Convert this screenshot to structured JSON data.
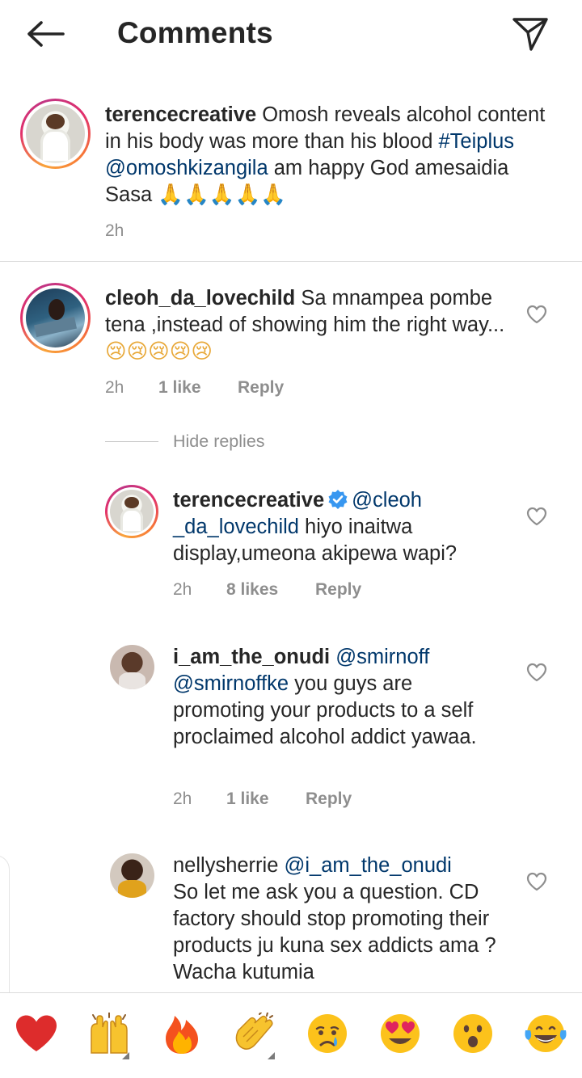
{
  "header": {
    "title": "Comments"
  },
  "caption": {
    "username": "terencecreative",
    "text_before": " Omosh reveals alcohol content in his body was more than his blood ",
    "hashtag": "#Teiplus",
    "space": " ",
    "mention": "@omoshkizangila",
    "text_after": " am happy God amesaidia Sasa ",
    "emojis": "🙏🙏🙏🙏🙏",
    "time": "2h"
  },
  "comments": [
    {
      "username": "cleoh_da_lovechild",
      "text": " Sa mnampea pombe tena ,instead of showing him the right way...",
      "emojis": "😢😢😢😢😢",
      "time": "2h",
      "likes": "1 like",
      "reply": "Reply"
    }
  ],
  "hide_replies": "Hide replies",
  "replies": [
    {
      "username": "terencecreative",
      "mention": "@cleoh _da_lovechild",
      "text": " hiyo inaitwa display,umeona akipewa wapi?",
      "time": "2h",
      "likes": "8 likes",
      "reply": "Reply"
    },
    {
      "username": "i_am_the_onudi",
      "mention1": "@smirnoff",
      "mention2": "@smirnoffke",
      "text": " you guys are promoting your products to a self proclaimed alcohol addict yawaa.",
      "time": "2h",
      "likes": "1 like",
      "reply": "Reply"
    },
    {
      "username": "nellysherrie",
      "mention": "@i_am_the_onudi",
      "text": "So let me ask you a question. CD factory should stop promoting their products ju kuna sex addicts ama ? Wacha kutumia"
    }
  ],
  "emoji_bar": [
    "❤️",
    "🙌",
    "🔥",
    "👏",
    "😢",
    "😍",
    "😮",
    "😂"
  ],
  "colors": {
    "mention": "#00376b",
    "secondary_text": "#8e8e8e",
    "verified_blue": "#3897f0",
    "heart_red": "#ed4956"
  }
}
